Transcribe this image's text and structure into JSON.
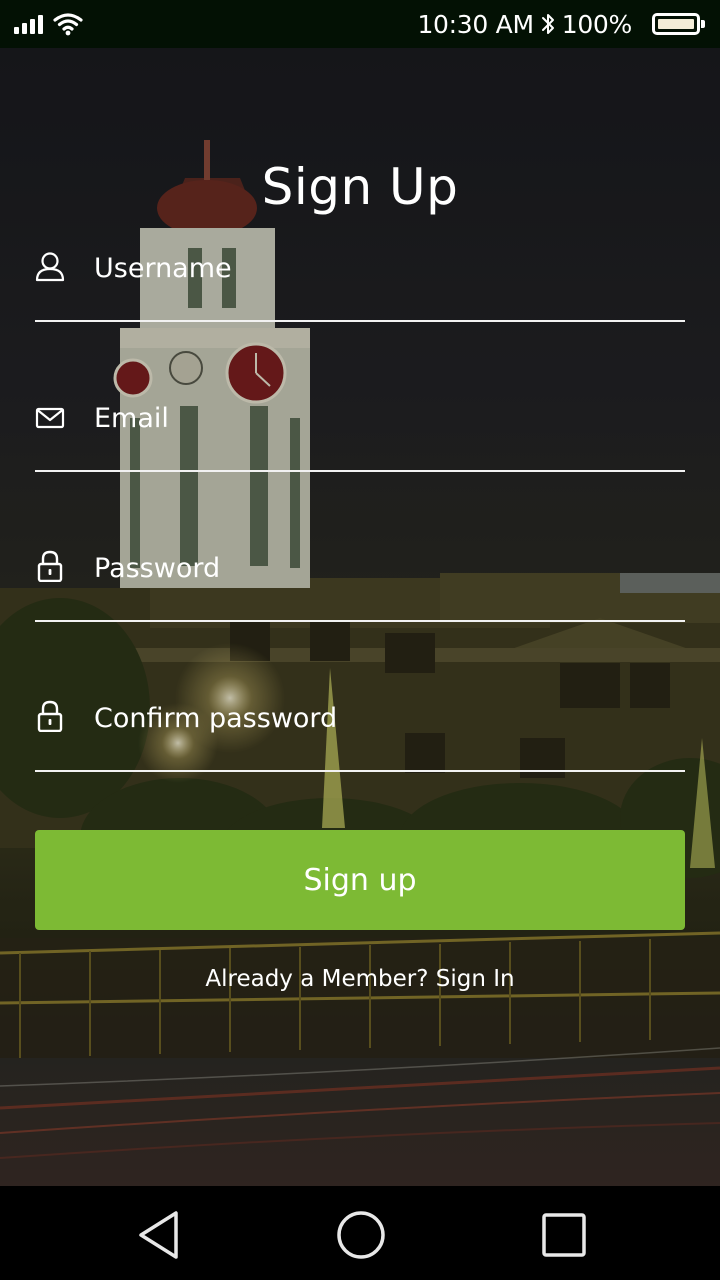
{
  "status_bar": {
    "time": "10:30 AM",
    "bluetooth_icon": "bluetooth-icon",
    "battery_percent": "100%",
    "signal_icon": "signal-icon",
    "wifi_icon": "wifi-icon"
  },
  "form": {
    "title": "Sign Up",
    "username_placeholder": "Username",
    "email_placeholder": "Email",
    "password_placeholder": "Password",
    "confirm_password_placeholder": "Confirm password",
    "signup_label": "Sign up",
    "signin_link": "Already a Member? Sign In"
  },
  "icons": {
    "username": "user-icon",
    "email": "envelope-icon",
    "password": "lock-icon",
    "confirm_password": "lock-icon"
  },
  "colors": {
    "accent": "#7dba34",
    "status_bar": "#031104",
    "nav_bar": "#000000"
  },
  "nav_bar": {
    "back": "back-triangle-icon",
    "home": "home-circle-icon",
    "recents": "recents-square-icon"
  }
}
